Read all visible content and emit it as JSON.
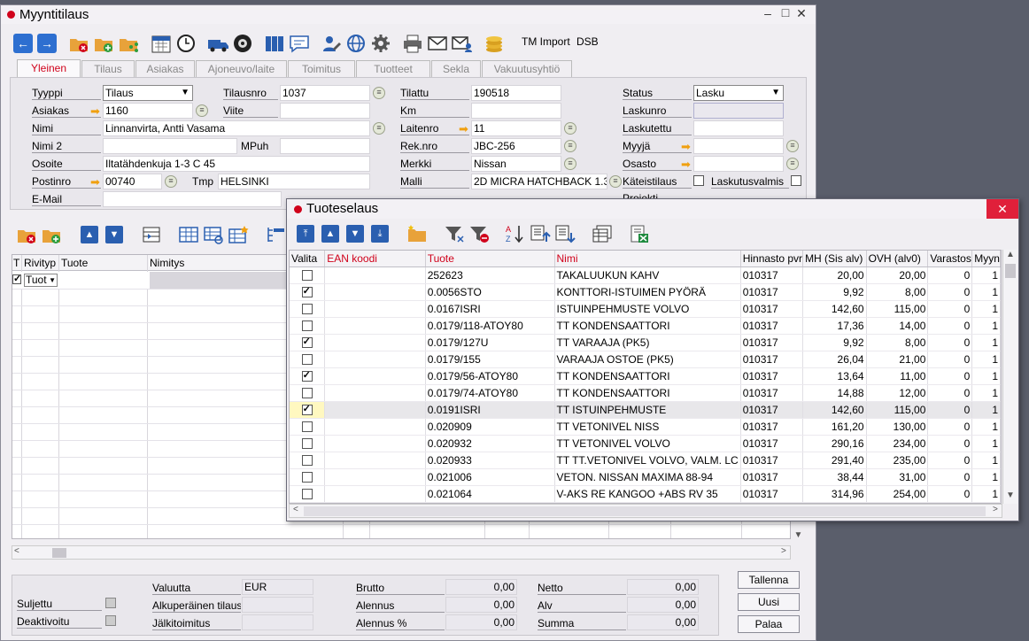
{
  "main_window": {
    "title": "Myyntitilaus",
    "toolbar_text": [
      "TM Import",
      "DSB"
    ],
    "tabs": [
      "Yleinen",
      "Tilaus",
      "Asiakas",
      "Ajoneuvo/laite",
      "Toimitus",
      "Tuotteet",
      "Sekla",
      "Vakuutusyhtiö"
    ],
    "active_tab": "Yleinen",
    "form": {
      "tyyppi_label": "Tyyppi",
      "tyyppi_value": "Tilaus",
      "asiakas_label": "Asiakas",
      "asiakas_value": "1160",
      "nimi_label": "Nimi",
      "nimi_value": "Linnanvirta, Antti Vasama",
      "nimi2_label": "Nimi 2",
      "nimi2_value": "",
      "osoite_label": "Osoite",
      "osoite_value": "Iltatähdenkuja 1-3 C 45",
      "postinro_label": "Postinro",
      "postinro_value": "00740",
      "email_label": "E-Mail",
      "email_value": "",
      "tilausnro_label": "Tilausnro",
      "tilausnro_value": "1037",
      "viite_label": "Viite",
      "viite_value": "",
      "mpuh_label": "MPuh",
      "mpuh_value": "",
      "tmp_label": "Tmp",
      "tmp_value": "HELSINKI",
      "tilattu_label": "Tilattu",
      "tilattu_value": "190518",
      "km_label": "Km",
      "km_value": "",
      "laitenro_label": "Laitenro",
      "laitenro_value": "11",
      "reknro_label": "Rek.nro",
      "reknro_value": "JBC-256",
      "merkki_label": "Merkki",
      "merkki_value": "Nissan",
      "malli_label": "Malli",
      "malli_value": "2D MICRA HATCHBACK 1.3",
      "status_label": "Status",
      "status_value": "Lasku",
      "laskunro_label": "Laskunro",
      "laskunro_value": "",
      "laskutettu_label": "Laskutettu",
      "laskutettu_value": "",
      "myyja_label": "Myyjä",
      "myyja_value": "",
      "osasto_label": "Osasto",
      "osasto_value": "",
      "kateistilaus_label": "Käteistilaus",
      "laskutusvalmis_label": "Laskutusvalmis",
      "projekti_label": "Projekti"
    },
    "order_grid": {
      "headers": [
        "T",
        "Rivityp",
        "Tuote",
        "Nimitys"
      ],
      "first_row_type": "Tuot"
    },
    "totals": {
      "suljettu_label": "Suljettu",
      "deaktivoitu_label": "Deaktivoitu",
      "valuutta_label": "Valuutta",
      "valuutta_value": "EUR",
      "alkuperainen_label": "Alkuperäinen tilaus",
      "alkuperainen_value": "",
      "jalkitoimitus_label": "Jälkitoimitus",
      "jalkitoimitus_value": "",
      "brutto_label": "Brutto",
      "brutto_value": "0,00",
      "alennus_label": "Alennus",
      "alennus_value": "0,00",
      "alennus_pct_label": "Alennus %",
      "alennus_pct_value": "0,00",
      "netto_label": "Netto",
      "netto_value": "0,00",
      "alv_label": "Alv",
      "alv_value": "0,00",
      "summa_label": "Summa",
      "summa_value": "0,00"
    },
    "buttons": {
      "tallenna": "Tallenna",
      "uusi": "Uusi",
      "palaa": "Palaa"
    }
  },
  "popup": {
    "title": "Tuoteselaus",
    "headers": [
      "Valita",
      "EAN koodi",
      "Tuote",
      "Nimi",
      "Hinnasto pvr",
      "MH (Sis alv)",
      "OVH (alv0)",
      "Varastos",
      "Myyn"
    ],
    "rows": [
      {
        "checked": false,
        "ean": "",
        "tuote": "252623",
        "nimi": "TAKALUUKUN KAHV",
        "pvm": "010317",
        "mh": "20,00",
        "ovh": "20,00",
        "varasto": "0",
        "myyn": "1"
      },
      {
        "checked": true,
        "ean": "",
        "tuote": "0.0056STO",
        "nimi": "KONTTORI-ISTUIMEN PYÖRÄ",
        "pvm": "010317",
        "mh": "9,92",
        "ovh": "8,00",
        "varasto": "0",
        "myyn": "1"
      },
      {
        "checked": false,
        "ean": "",
        "tuote": "0.0167ISRI",
        "nimi": "ISTUINPEHMUSTE VOLVO",
        "pvm": "010317",
        "mh": "142,60",
        "ovh": "115,00",
        "varasto": "0",
        "myyn": "1"
      },
      {
        "checked": false,
        "ean": "",
        "tuote": "0.0179/118-ATOY80",
        "nimi": "TT KONDENSAATTORI",
        "pvm": "010317",
        "mh": "17,36",
        "ovh": "14,00",
        "varasto": "0",
        "myyn": "1"
      },
      {
        "checked": true,
        "ean": "",
        "tuote": "0.0179/127U",
        "nimi": "TT VARAAJA (PK5)",
        "pvm": "010317",
        "mh": "9,92",
        "ovh": "8,00",
        "varasto": "0",
        "myyn": "1"
      },
      {
        "checked": false,
        "ean": "",
        "tuote": "0.0179/155",
        "nimi": "VARAAJA OSTOE (PK5)",
        "pvm": "010317",
        "mh": "26,04",
        "ovh": "21,00",
        "varasto": "0",
        "myyn": "1"
      },
      {
        "checked": true,
        "ean": "",
        "tuote": "0.0179/56-ATOY80",
        "nimi": "TT KONDENSAATTORI",
        "pvm": "010317",
        "mh": "13,64",
        "ovh": "11,00",
        "varasto": "0",
        "myyn": "1"
      },
      {
        "checked": false,
        "ean": "",
        "tuote": "0.0179/74-ATOY80",
        "nimi": "TT KONDENSAATTORI",
        "pvm": "010317",
        "mh": "14,88",
        "ovh": "12,00",
        "varasto": "0",
        "myyn": "1"
      },
      {
        "checked": true,
        "ean": "",
        "tuote": "0.0191ISRI",
        "nimi": "TT ISTUINPEHMUSTE",
        "pvm": "010317",
        "mh": "142,60",
        "ovh": "115,00",
        "varasto": "0",
        "myyn": "1",
        "highlight": true
      },
      {
        "checked": false,
        "ean": "",
        "tuote": "0.020909",
        "nimi": "TT VETONIVEL NISS",
        "pvm": "010317",
        "mh": "161,20",
        "ovh": "130,00",
        "varasto": "0",
        "myyn": "1"
      },
      {
        "checked": false,
        "ean": "",
        "tuote": "0.020932",
        "nimi": "TT VETONIVEL VOLVO",
        "pvm": "010317",
        "mh": "290,16",
        "ovh": "234,00",
        "varasto": "0",
        "myyn": "1"
      },
      {
        "checked": false,
        "ean": "",
        "tuote": "0.020933",
        "nimi": "TT TT.VETONIVEL VOLVO, VALM. LC",
        "pvm": "010317",
        "mh": "291,40",
        "ovh": "235,00",
        "varasto": "0",
        "myyn": "1"
      },
      {
        "checked": false,
        "ean": "",
        "tuote": "0.021006",
        "nimi": "VETON. NISSAN MAXIMA 88-94",
        "pvm": "010317",
        "mh": "38,44",
        "ovh": "31,00",
        "varasto": "0",
        "myyn": "1"
      },
      {
        "checked": false,
        "ean": "",
        "tuote": "0.021064",
        "nimi": "V-AKS RE KANGOO +ABS RV 35",
        "pvm": "010317",
        "mh": "314,96",
        "ovh": "254,00",
        "varasto": "0",
        "myyn": "1"
      }
    ]
  }
}
